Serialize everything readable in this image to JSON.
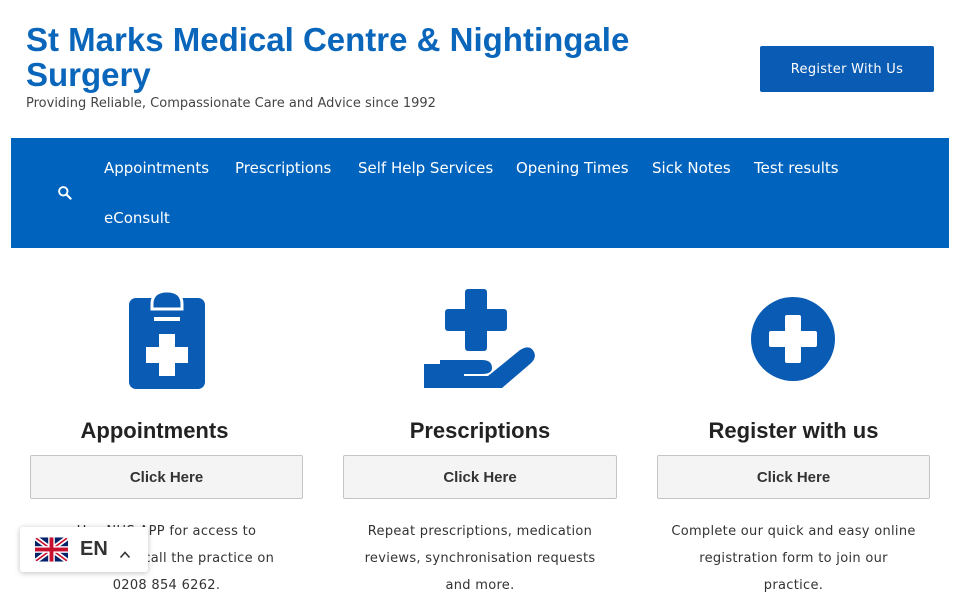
{
  "header": {
    "site_title": "St Marks Medical Centre & Nightingale Surgery",
    "tagline": "Providing Reliable, Compassionate Care and Advice since 1992",
    "register_label": "Register With Us"
  },
  "nav": {
    "search_icon": "search-icon",
    "items": [
      "Appointments",
      "Prescriptions",
      "Self Help Services",
      "Opening Times",
      "Sick Notes",
      "Test results",
      "eConsult"
    ]
  },
  "columns": [
    {
      "icon": "clipboard-medical-icon",
      "title": "Appointments",
      "button": "Click Here",
      "desc_line1": "Use NHS APP for access to",
      "desc_line2": "services OR call the practice on",
      "desc_line3": "0208 854 6262."
    },
    {
      "icon": "hand-medical-icon",
      "title": "Prescriptions",
      "button": "Click Here",
      "desc_line1": "Repeat prescriptions, medication",
      "desc_line2": "reviews, synchronisation requests",
      "desc_line3": "and more."
    },
    {
      "icon": "plus-circle-icon",
      "title": "Register with us",
      "button": "Click Here",
      "desc_line1": "Complete our quick and easy online",
      "desc_line2": "registration form to join our",
      "desc_line3": "practice."
    }
  ],
  "language": {
    "code": "EN",
    "flag_icon": "uk-flag-icon",
    "toggle_icon": "chevron-up-icon"
  },
  "colors": {
    "brand": "#0a66bb",
    "nav_bg": "#0063be",
    "button_bg": "#0a5bb3"
  }
}
